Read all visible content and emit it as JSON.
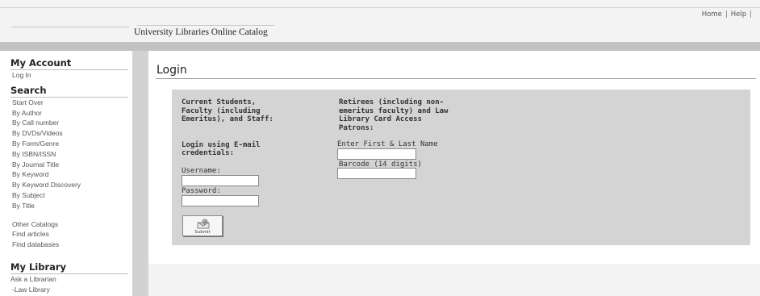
{
  "header": {
    "links": [
      "Home",
      "Help"
    ],
    "site_title": "University Libraries Online Catalog"
  },
  "sidebar": {
    "my_account": {
      "heading": "My Account",
      "items": [
        "Log In"
      ]
    },
    "search": {
      "heading": "Search",
      "items": [
        "Start Over",
        "By Author",
        "By Call number",
        "By DVDs/Videos",
        "By Form/Genre",
        "By ISBN/ISSN",
        "By Journal Title",
        "By Keyword",
        "By Keyword Discovery",
        "By Subject",
        "By Title"
      ],
      "other": [
        "Other Catalogs",
        "Find articles",
        "Find databases"
      ]
    },
    "my_library": {
      "heading": "My Library",
      "items": [
        "Ask a Librarian",
        "-Law Library"
      ]
    }
  },
  "main": {
    "title": "Login",
    "col1": {
      "heading": "Current Students, Faculty (including Emeritus), and Staff:",
      "subheading": "Login using E-mail credentials:",
      "username_label": "Username:",
      "username_value": "",
      "password_label": "Password:",
      "password_value": ""
    },
    "col2": {
      "heading": "Retirees (including non-emeritus faculty) and Law Library Card Access Patrons:",
      "name_label": "Enter First & Last Name",
      "name_value": "",
      "barcode_label": "Barcode (14 digits)",
      "barcode_value": ""
    },
    "submit_label": "Submit"
  }
}
